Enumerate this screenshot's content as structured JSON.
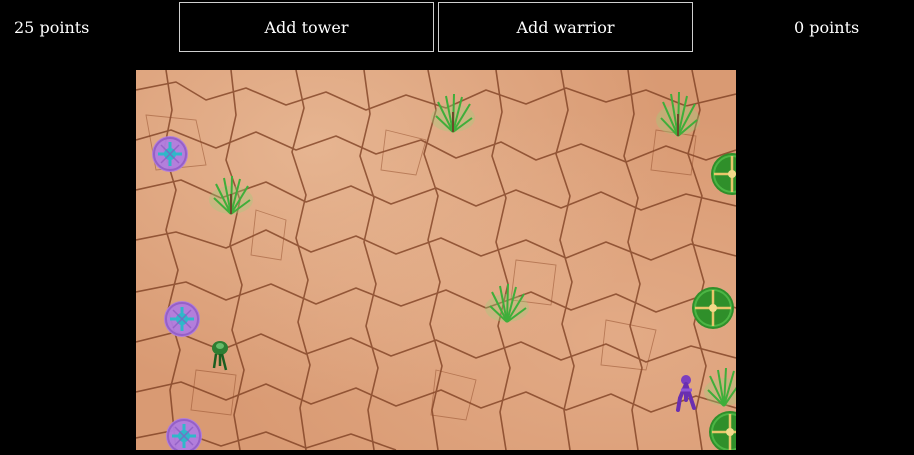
{
  "header": {
    "player_score": "25 points",
    "enemy_score": "0 points",
    "add_tower_label": "Add tower",
    "add_warrior_label": "Add warrior"
  },
  "board": {
    "ground_color": "#d99a73",
    "crack_color": "#7a3b1e",
    "player_tower_color": "#b07ce0",
    "player_tower_core": "#2fb8c9",
    "enemy_tower_color": "#2f8f2a",
    "enemy_tower_cross": "#e9c66a",
    "bush_color": "#3fae3a",
    "player_towers": [
      {
        "icon": "purple-tower-icon"
      },
      {
        "icon": "purple-tower-icon"
      },
      {
        "icon": "purple-tower-icon"
      }
    ],
    "enemy_towers": [
      {
        "icon": "green-tower-icon"
      },
      {
        "icon": "green-tower-icon"
      },
      {
        "icon": "green-tower-icon"
      }
    ],
    "bushes": 5,
    "units": [
      {
        "icon": "green-warrior-icon"
      },
      {
        "icon": "purple-warrior-icon"
      }
    ]
  }
}
